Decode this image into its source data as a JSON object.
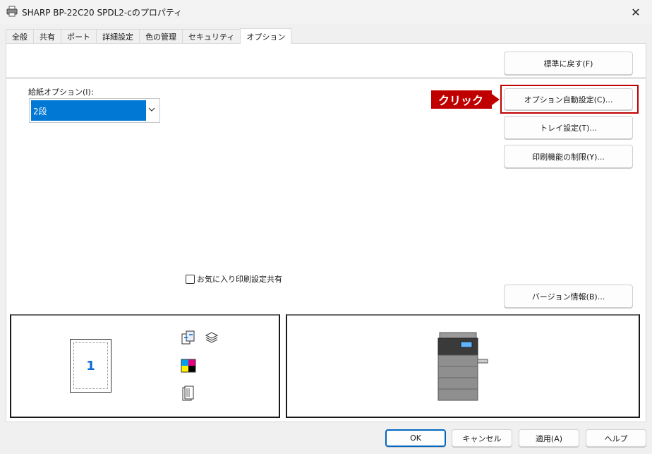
{
  "window": {
    "title": "SHARP BP-22C20 SPDL2-cのプロパティ",
    "close_glyph": "✕"
  },
  "tabs": [
    {
      "label": "全般"
    },
    {
      "label": "共有"
    },
    {
      "label": "ポート"
    },
    {
      "label": "詳細設定"
    },
    {
      "label": "色の管理"
    },
    {
      "label": "セキュリティ"
    },
    {
      "label": "オプション"
    }
  ],
  "active_tab": "オプション",
  "options": {
    "restore_defaults": "標準に戻す(F)",
    "auto_config": "オプション自動設定(C)...",
    "tray_settings": "トレイ設定(T)...",
    "print_restrictions": "印刷機能の制限(Y)...",
    "version_info": "バージョン情報(B)...",
    "paper_feed_label": "給紙オプション(I):",
    "paper_feed_value": "2段",
    "favorites_share_label": "お気に入り印刷設定共有",
    "favorites_share_checked": false
  },
  "annotation": {
    "callout_text": "クリック",
    "color": "#c00000"
  },
  "preview": {
    "page_number": "1"
  },
  "footer": {
    "ok": "OK",
    "cancel": "キャンセル",
    "apply": "適用(A)",
    "help": "ヘルプ"
  },
  "colors": {
    "accent": "#0078d4",
    "default_button_border": "#0067c0"
  }
}
